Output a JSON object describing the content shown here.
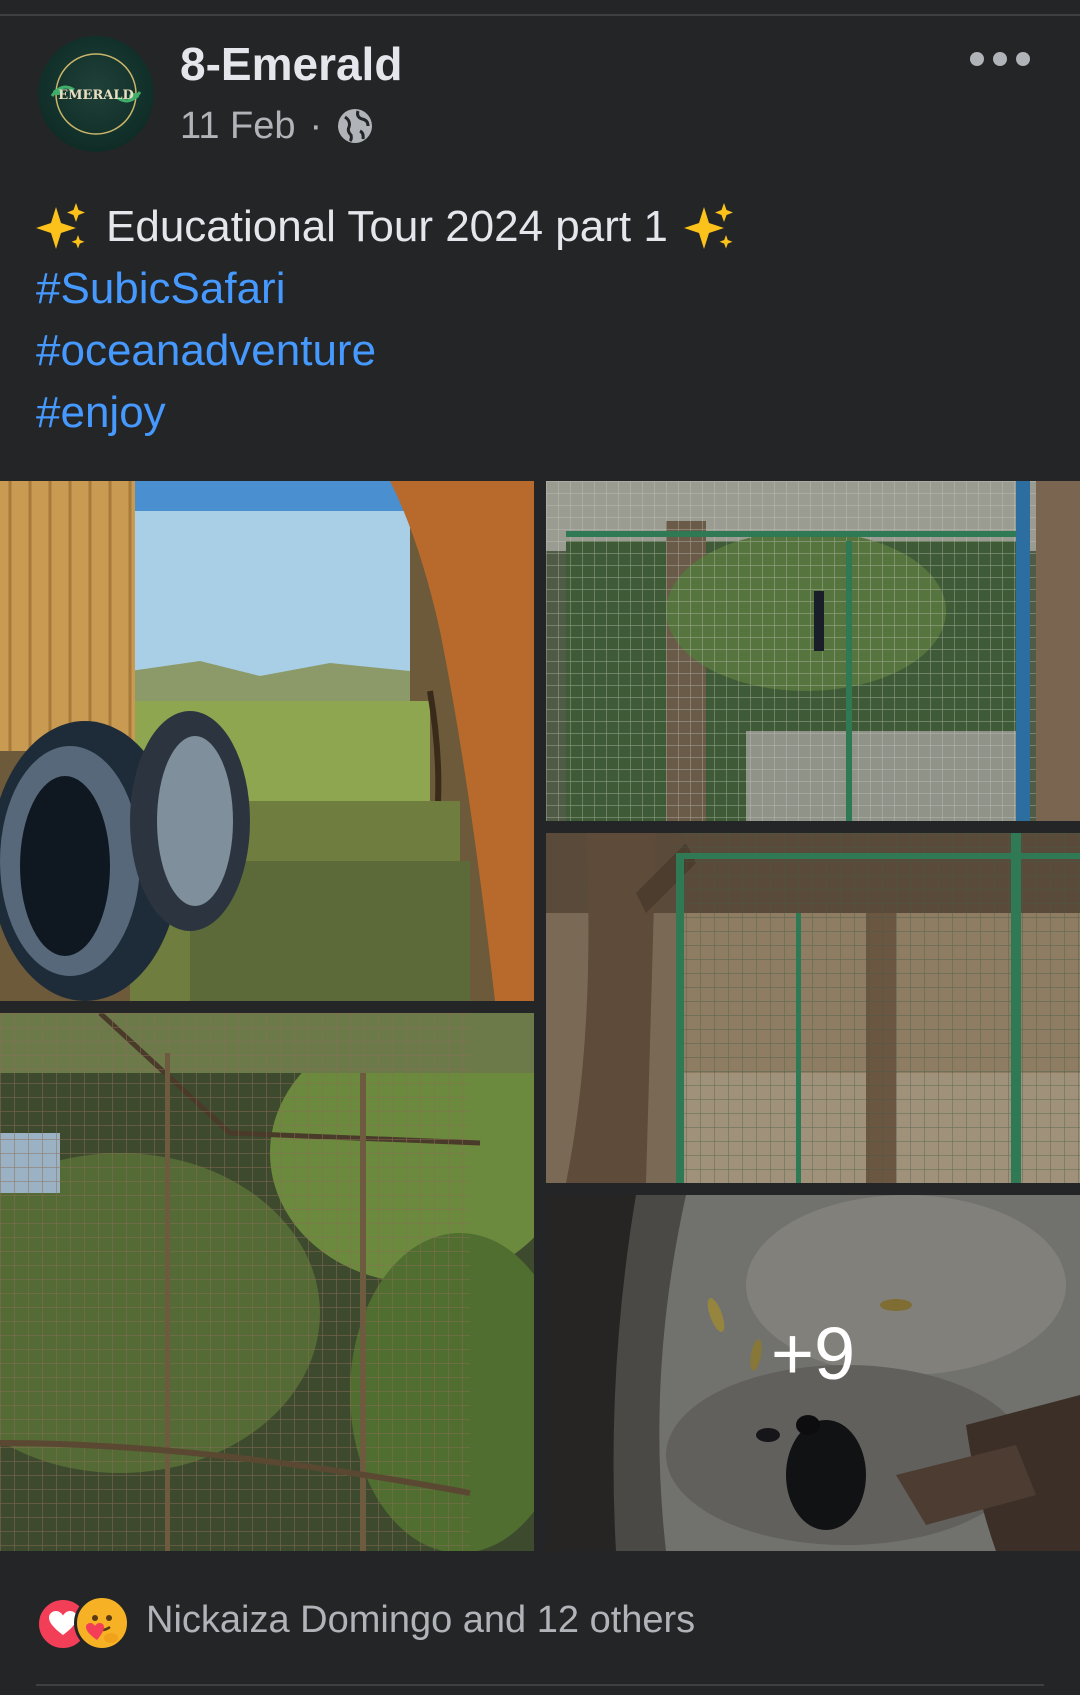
{
  "post": {
    "page_name": "8-Emerald",
    "avatar_text": "EMERALD",
    "date": "11 Feb",
    "separator": "·",
    "privacy_icon": "globe-icon",
    "menu_icon": "more-horizontal-icon",
    "title": "Educational Tour 2024 part 1",
    "title_emoji": "sparkles-icon",
    "hashtags": [
      "#SubicSafari",
      "#oceanadventure",
      "#enjoy"
    ]
  },
  "photos": {
    "items": [
      {
        "description": "bus window view of hills with curtain"
      },
      {
        "description": "wire mesh bird enclosure under trees"
      },
      {
        "description": "green metal cage enclosure with tree trunk"
      },
      {
        "description": "wire mesh enclosure with foliage"
      },
      {
        "description": "turtle on rock floor"
      }
    ],
    "more_count": "+9"
  },
  "reactions": {
    "icons": [
      "love-reaction-icon",
      "care-reaction-icon"
    ],
    "summary": "Nickaiza Domingo and 12 others"
  },
  "colors": {
    "background": "#242526",
    "text_primary": "#e4e6eb",
    "text_secondary": "#b0b3b8",
    "hashtag": "#4599ff",
    "love": "#f33e58",
    "care": "#f7b125"
  }
}
